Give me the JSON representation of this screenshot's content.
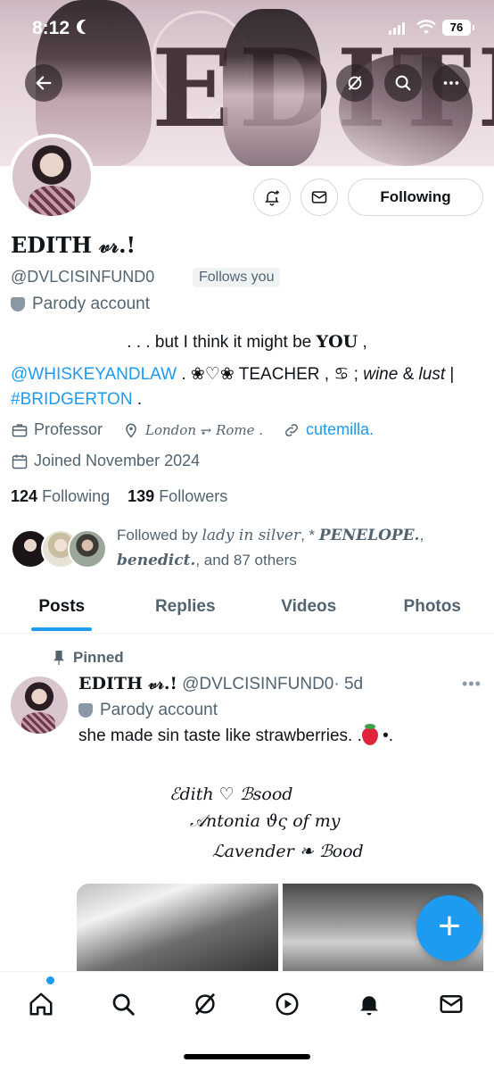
{
  "status_bar": {
    "time": "8:12",
    "battery": "76"
  },
  "banner": {
    "text": "EDITH"
  },
  "profile": {
    "name": "EDITH 𝓋𝓇.!",
    "handle": "@DVLCISINFUND0",
    "follows_you": "Follows you",
    "parody_label": "Parody account",
    "following_button": "Following"
  },
  "bio": {
    "line1_prefix": ". . . but I think it might be ",
    "line1_bold": "YOU",
    "line1_suffix": " ,",
    "mention": "@WHISKEYANDLAW",
    "mid": " . ❀♡❀ TEACHER , ♋ ; ",
    "wine": "wine",
    "amp": " & ",
    "lust": "lust",
    "pipe": " |",
    "hashtag": "#BRIDGERTON",
    "end": " ."
  },
  "meta": {
    "profession": "Professor",
    "location": "London ⥅ Rome .",
    "website": "cutemilla.",
    "joined": "Joined November 2024"
  },
  "counts": {
    "following_num": "124",
    "following_label": "Following",
    "followers_num": "139",
    "followers_label": "Followers"
  },
  "followed_by": {
    "prefix": "Followed by ",
    "name1": "lady in silver",
    "sep1": ", * ",
    "name2": "PENELOPE.",
    "sep2": ",",
    "name3": "benedict.",
    "suffix": ", and 87 others"
  },
  "tabs": [
    "Posts",
    "Replies",
    "Videos",
    "Photos"
  ],
  "post": {
    "pinned": "Pinned",
    "name": "EDITH 𝓋𝓇.!",
    "handle": "@DVLCISINFUND0",
    "time": "· 5d",
    "parody_label": "Parody account",
    "text_before": "she made sin taste like strawberries. .",
    "text_after": " •.",
    "verse1": "ℰdith ♡ ℬsood",
    "verse2": "𝒜ntonia ϑς of my",
    "verse3": "ℒavender ❧ ℬood"
  },
  "colors": {
    "accent": "#1d9bf0",
    "muted": "#536471",
    "text": "#0f1419"
  },
  "icons": [
    "back-arrow-icon",
    "grok-icon",
    "search-icon",
    "more-icon",
    "bell-plus-icon",
    "mail-icon",
    "briefcase-icon",
    "location-icon",
    "link-icon",
    "calendar-icon",
    "pin-icon",
    "home-icon",
    "explore-icon",
    "grok-icon",
    "video-icon",
    "notifications-icon",
    "messages-icon"
  ]
}
